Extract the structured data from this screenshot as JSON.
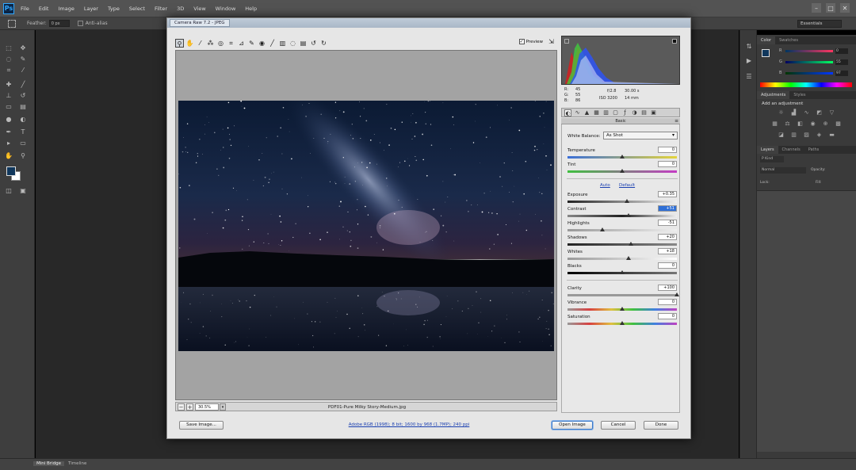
{
  "photoshop": {
    "logo": "Ps",
    "menu": [
      "File",
      "Edit",
      "Image",
      "Layer",
      "Type",
      "Select",
      "Filter",
      "3D",
      "View",
      "Window",
      "Help"
    ],
    "window_controls": [
      "–",
      "□",
      "✕"
    ],
    "options_bar": {
      "feather_label": "Feather:",
      "feather_value": "0 px",
      "anti_alias_label": "Anti-alias"
    },
    "workspace": "Essentials",
    "panels": {
      "color_tabs": [
        "Color",
        "Swatches"
      ],
      "color_values": {
        "r": "0",
        "g": "55",
        "b": "97"
      },
      "adjustments_tabs": [
        "Adjustments",
        "Styles"
      ],
      "adjustments_heading": "Add an adjustment",
      "layers_tabs": [
        "Layers",
        "Channels",
        "Paths"
      ],
      "layers_kind": "P Kind",
      "layers_blend": "Normal",
      "layers_opacity_label": "Opacity:",
      "layers_lock_label": "Lock:",
      "layers_fill_label": "Fill:"
    },
    "status_tabs": [
      "Mini Bridge",
      "Timeline"
    ],
    "colors": {
      "foreground": "#10375c",
      "background": "#ffffff"
    }
  },
  "camera_raw": {
    "title": "Camera Raw 7.2  -  JPEG",
    "preview_label": "Preview",
    "preview_checked": "✓",
    "zoom": "30.5%",
    "filename": "PDF01-Pure Milky Story-Medium.jpg",
    "workflow_link": "Adobe RGB (1998); 8 bit; 1600 by 968 (1.7MP); 240 ppi",
    "buttons": {
      "save": "Save Image...",
      "open": "Open Image",
      "cancel": "Cancel",
      "done": "Done"
    },
    "readout": {
      "r_label": "R:",
      "r_value": "45",
      "g_label": "G:",
      "g_value": "55",
      "b_label": "B:",
      "b_value": "86",
      "aperture": "f/2.8",
      "shutter": "30.00 s",
      "iso": "ISO 3200",
      "focal": "14 mm"
    },
    "panel_title": "Basic",
    "white_balance": {
      "label": "White Balance:",
      "value": "As Shot"
    },
    "auto_label": "Auto",
    "default_label": "Default",
    "controls": [
      {
        "name": "temperature",
        "label": "Temperature",
        "value": "0",
        "level": 0.5
      },
      {
        "name": "tint",
        "label": "Tint",
        "value": "0",
        "level": 0.5
      },
      {
        "name": "exposure",
        "label": "Exposure",
        "value": "+0.35",
        "level": 0.54
      },
      {
        "name": "contrast",
        "label": "Contrast",
        "value": "+51",
        "level": 0.56,
        "selected": true
      },
      {
        "name": "highlights",
        "label": "Highlights",
        "value": "-51",
        "level": 0.32
      },
      {
        "name": "shadows",
        "label": "Shadows",
        "value": "+20",
        "level": 0.58
      },
      {
        "name": "whites",
        "label": "Whites",
        "value": "+18",
        "level": 0.56
      },
      {
        "name": "blacks",
        "label": "Blacks",
        "value": "0",
        "level": 0.5
      },
      {
        "name": "clarity",
        "label": "Clarity",
        "value": "+100",
        "level": 1.0
      },
      {
        "name": "vibrance",
        "label": "Vibrance",
        "value": "0",
        "level": 0.5
      },
      {
        "name": "saturation",
        "label": "Saturation",
        "value": "0",
        "level": 0.5
      }
    ]
  }
}
